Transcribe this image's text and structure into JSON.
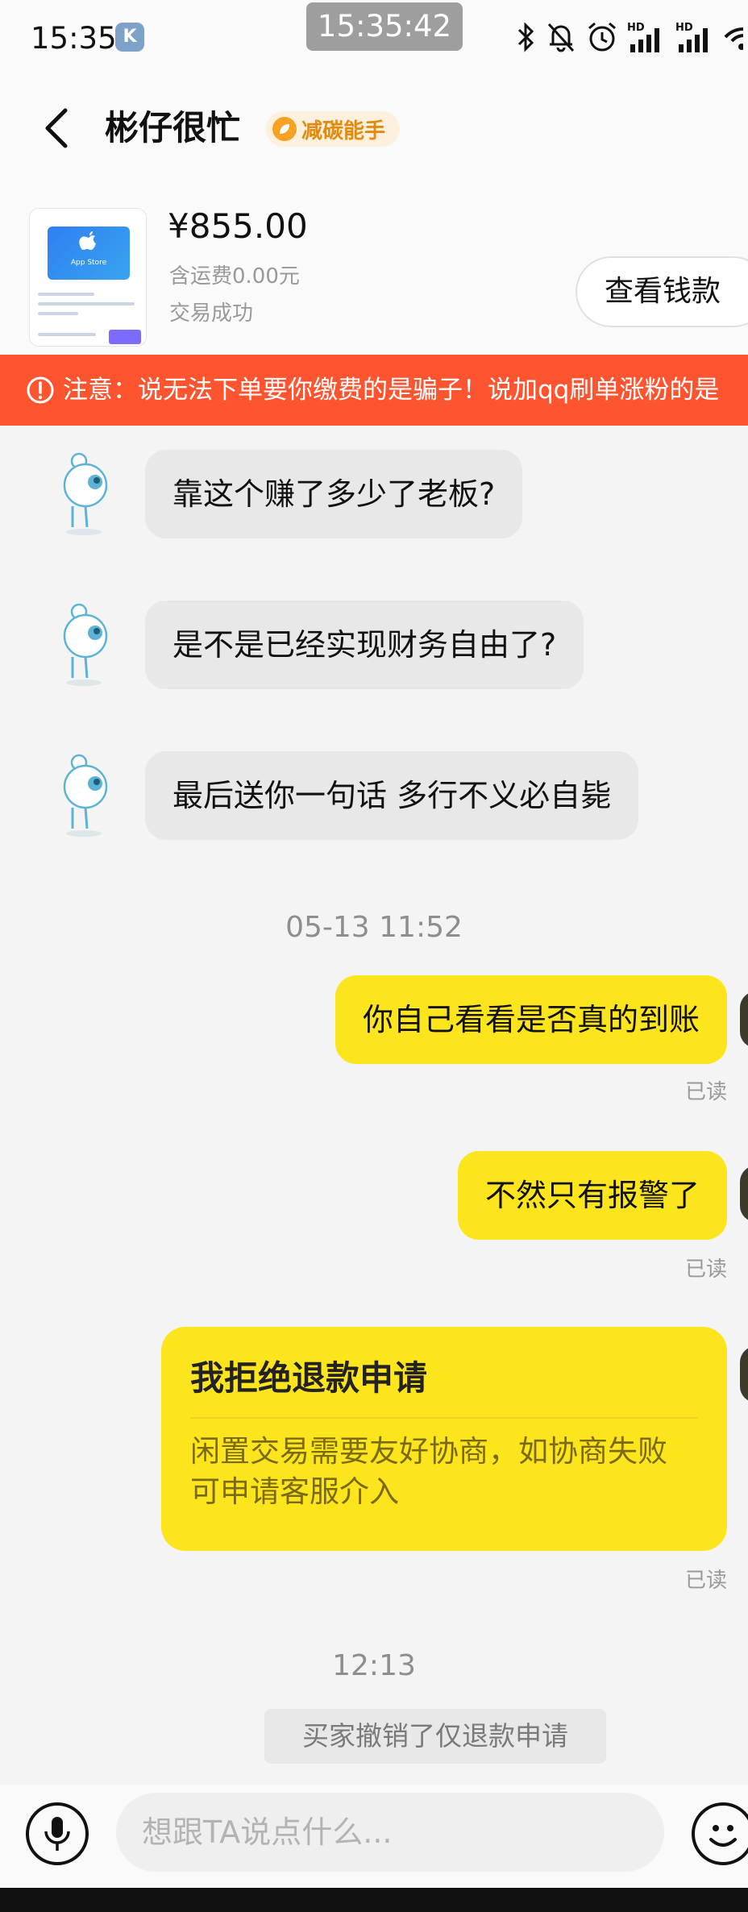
{
  "status_bar": {
    "time": "15:35",
    "app_badge": "K",
    "clock_overlay": "15:35:42",
    "signal_label_1": "HD",
    "signal_label_2": "HD"
  },
  "header": {
    "title": "彬仔很忙",
    "badge": "减碳能手"
  },
  "product": {
    "thumbnail_label": "App Store",
    "price": "¥855.00",
    "shipping": "含运费0.00元",
    "status": "交易成功",
    "wallet_button": "查看钱款"
  },
  "warning": {
    "text": "注意：说无法下单要你缴费的是骗子！说加qq刷单涨粉的是"
  },
  "messages": {
    "in_1": "靠这个赚了多少了老板?",
    "in_2": "是不是已经实现财务自由了?",
    "in_3": "最后送你一句话 多行不义必自毙",
    "time_1": "05-13 11:52",
    "out_1": "你自己看看是否真的到账",
    "out_1_status": "已读",
    "out_2": "不然只有报警了",
    "out_2_status": "已读",
    "card_title": "我拒绝退款申请",
    "card_body": "闲置交易需要友好协商，如协商失败可申请客服介入",
    "card_status": "已读",
    "time_2": "12:13",
    "system_note": "买家撤销了仅退款申请"
  },
  "input": {
    "placeholder": "想跟TA说点什么..."
  },
  "colors": {
    "warning_bg": "#fe5430",
    "bubble_out": "#fde51e",
    "bubble_in": "#e8e8e8",
    "badge_text": "#e58a10"
  },
  "icons": [
    "back-arrow-icon",
    "bluetooth-icon",
    "bell-off-icon",
    "alarm-icon",
    "signal-icon",
    "wifi-icon",
    "warning-icon",
    "mic-icon",
    "emoji-icon",
    "leaf-icon"
  ]
}
